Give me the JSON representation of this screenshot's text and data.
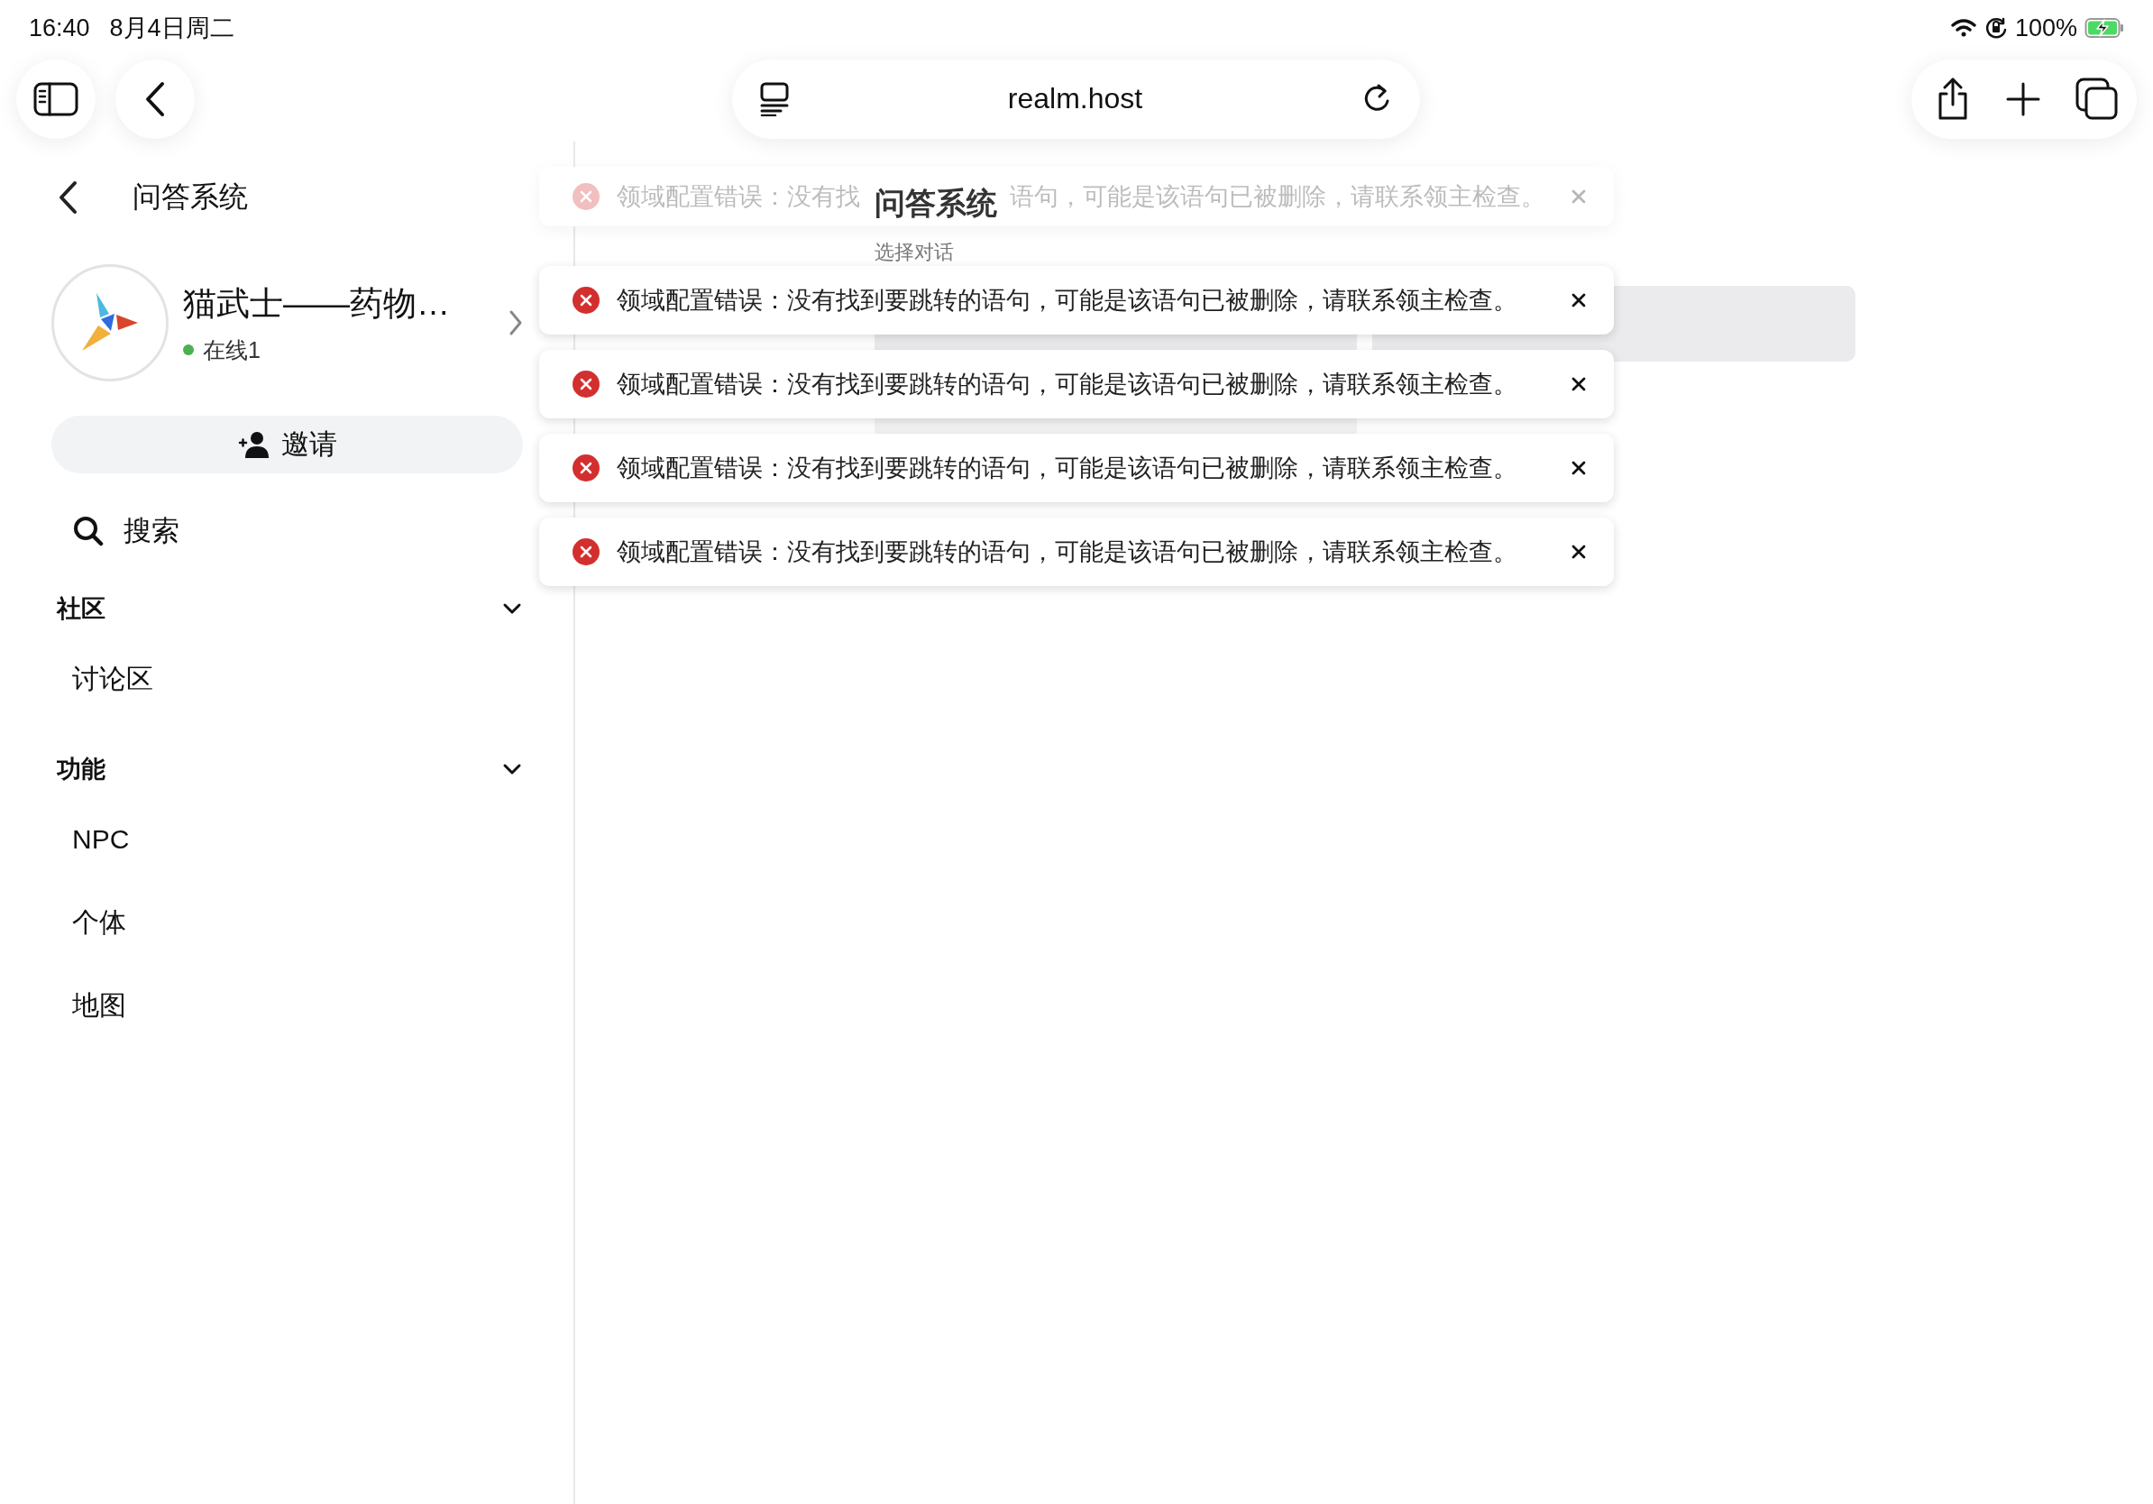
{
  "status_bar": {
    "time": "16:40",
    "date": "8月4日周二",
    "battery": "100%",
    "charging": true
  },
  "browser": {
    "url": "realm.host"
  },
  "sidebar": {
    "title": "问答系统",
    "realm": {
      "name": "猫武士——药物…",
      "online": "在线1"
    },
    "invite": "邀请",
    "search": "搜索",
    "sections": [
      {
        "title": "社区",
        "expanded": true,
        "items": [
          "讨论区"
        ]
      },
      {
        "title": "功能",
        "expanded": true,
        "items": [
          "NPC",
          "个体",
          "地图"
        ]
      }
    ]
  },
  "main": {
    "title": "问答系统",
    "subtitle": "选择对话"
  },
  "toasts": [
    {
      "kind": "error",
      "faded": true,
      "text_parts": [
        "领域配置错误：没有找",
        "语句，可能是该语句已被删除，请联系领主检查。"
      ]
    },
    {
      "kind": "error",
      "faded": false,
      "text_parts": [
        "领域配置错误：没有找到要跳转的语句，可能是该语句已被删除，请联系领主检查。"
      ]
    },
    {
      "kind": "error",
      "faded": false,
      "text_parts": [
        "领域配置错误：没有找到要跳转的语句，可能是该语句已被删除，请联系领主检查。"
      ]
    },
    {
      "kind": "error",
      "faded": false,
      "text_parts": [
        "领域配置错误：没有找到要跳转的语句，可能是该语句已被删除，请联系领主检查。"
      ]
    },
    {
      "kind": "error",
      "faded": false,
      "text_parts": [
        "领域配置错误：没有找到要跳转的语句，可能是该语句已被删除，请联系领主检查。"
      ]
    }
  ]
}
